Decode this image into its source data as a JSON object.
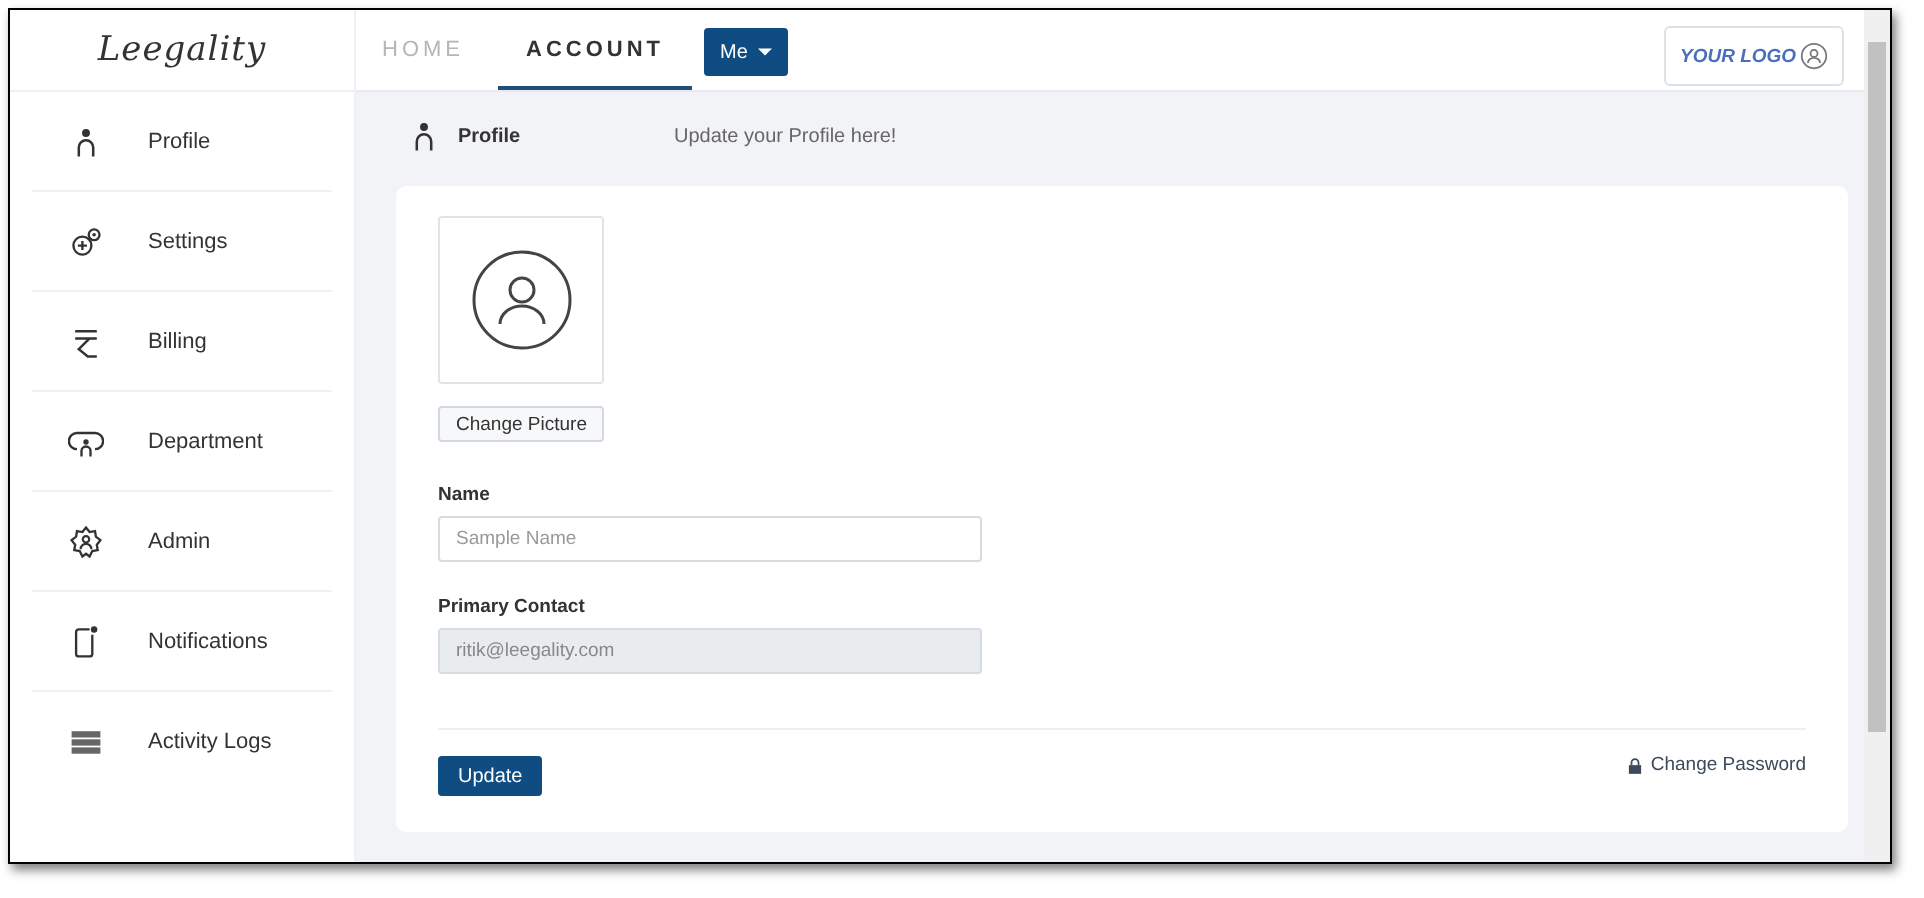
{
  "logo": "Leegality",
  "tabs": [
    {
      "label": "HOME",
      "selected": false
    },
    {
      "label": "ACCOUNT",
      "selected": true
    }
  ],
  "user_menu": {
    "label": "Me"
  },
  "brand_badge": {
    "label": "YOUR LOGO"
  },
  "sidebar": {
    "items": [
      {
        "label": "Profile"
      },
      {
        "label": "Settings"
      },
      {
        "label": "Billing"
      },
      {
        "label": "Department"
      },
      {
        "label": "Admin"
      },
      {
        "label": "Notifications"
      },
      {
        "label": "Activity Logs"
      }
    ]
  },
  "page_header": {
    "title": "Profile",
    "subtitle": "Update your Profile here!"
  },
  "form": {
    "change_picture": "Change Picture",
    "fields": [
      {
        "label": "Name",
        "placeholder": "Sample Name",
        "disabled": false
      },
      {
        "label": "Primary Contact",
        "value": "ritik@leegality.com",
        "disabled": true
      }
    ],
    "submit": "Update",
    "change_password": "Change Password"
  }
}
